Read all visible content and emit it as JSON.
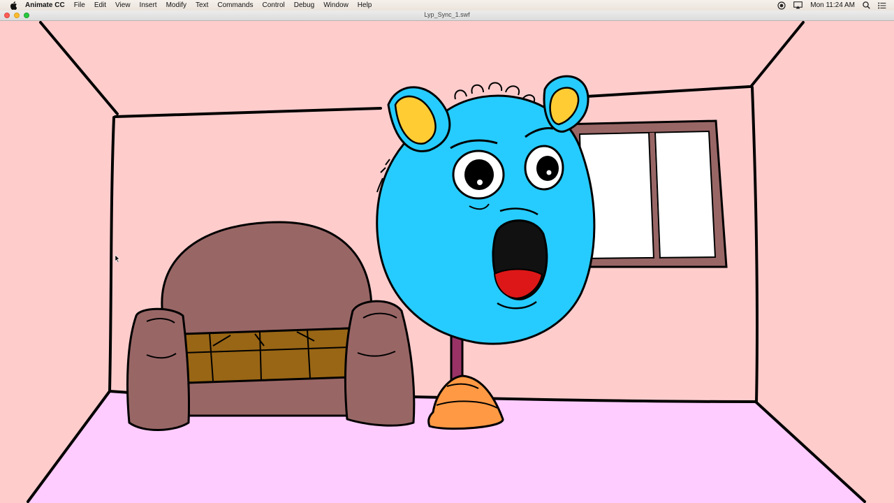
{
  "menubar": {
    "apple_icon": "apple-icon",
    "app_name": "Animate CC",
    "items": [
      "File",
      "Edit",
      "View",
      "Insert",
      "Modify",
      "Text",
      "Commands",
      "Control",
      "Debug",
      "Window",
      "Help"
    ],
    "clock": "Mon 11:24 AM",
    "status_icons": [
      "screen-record-icon",
      "airplay-display-icon",
      "spotlight-search-icon",
      "notification-list-icon"
    ]
  },
  "window": {
    "title": "Lyp_Sync_1.swf"
  },
  "colors": {
    "wall": "#ffcccc",
    "floor": "#ffccff",
    "character_head": "#26ccff",
    "ear_inner": "#ffcc33",
    "couch": "#996666",
    "couch_cushion": "#996615",
    "window_frame": "#996666",
    "stand_pole": "#993366",
    "stand_base": "#ff9944",
    "tongue": "#dd1717"
  }
}
